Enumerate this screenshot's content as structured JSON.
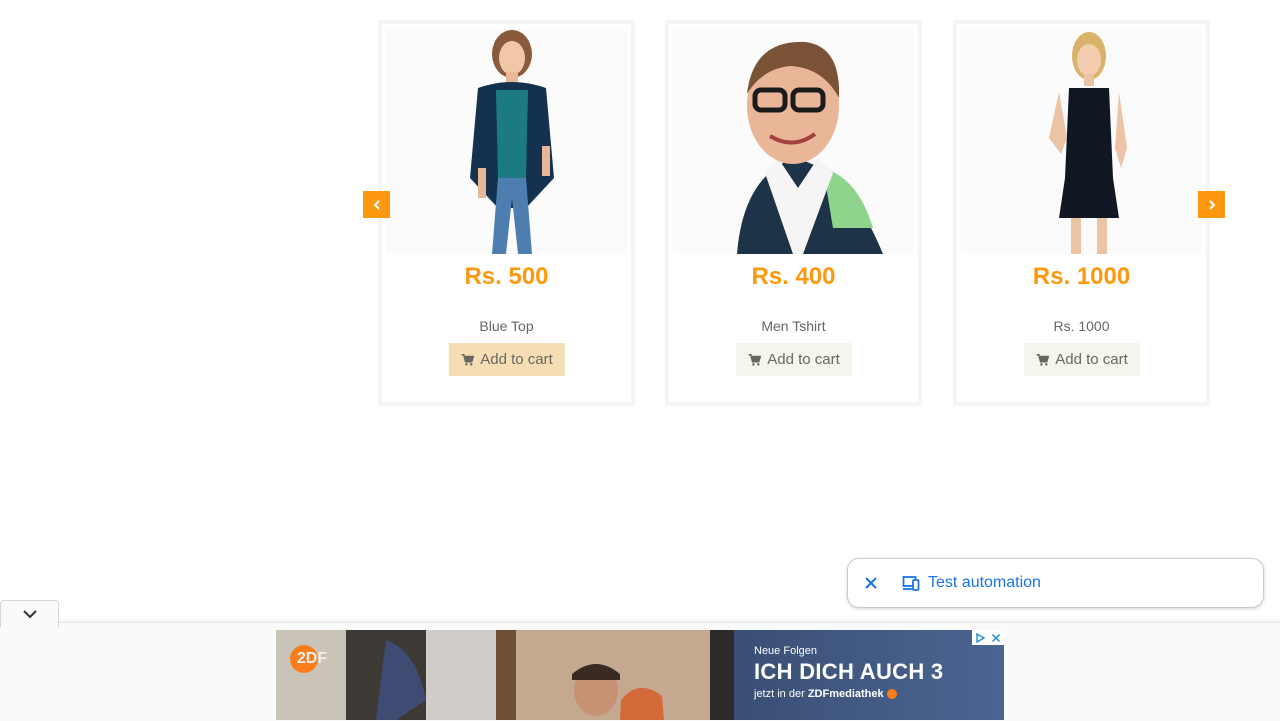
{
  "products": [
    {
      "price": "Rs. 500",
      "name": "Blue Top",
      "button": "Add to cart",
      "image": "woman-blue-top-photo"
    },
    {
      "price": "Rs. 400",
      "name": "Men Tshirt",
      "button": "Add to cart",
      "image": "man-tshirt-photo"
    },
    {
      "price": "Rs. 1000",
      "name": "Rs. 1000",
      "button": "Add to cart",
      "image": "woman-black-dress-photo"
    }
  ],
  "carousel": {
    "prev_icon": "chevron-left-icon",
    "next_icon": "chevron-right-icon",
    "accent": "#fe980f"
  },
  "automation_bar": {
    "label": "Test automation",
    "close_icon": "close-icon",
    "device_icon": "devices-icon",
    "link_color": "#1a73e8"
  },
  "ad": {
    "logo": "2DF",
    "kicker": "Neue Folgen",
    "headline": "ICH DICH AUCH 3",
    "sub_prefix": "jetzt in der ",
    "sub_brand": "ZDFmediathek",
    "collapse_icon": "chevron-down-icon",
    "adchoices_icon": "adchoices-icon",
    "close_icon": "close-icon",
    "brand_color": "#fa7d19"
  }
}
